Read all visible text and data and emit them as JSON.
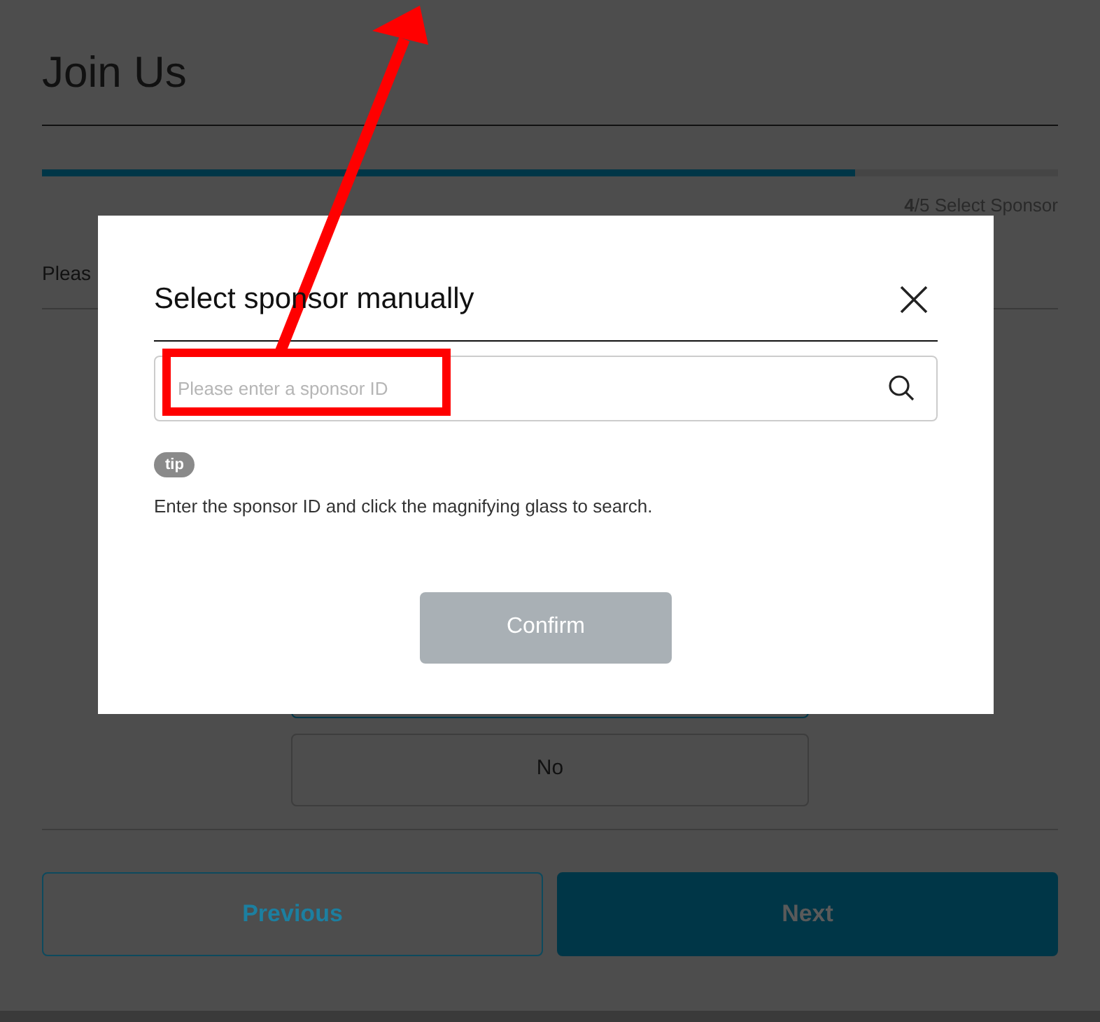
{
  "page": {
    "title": "Join Us",
    "progress": {
      "level": 0.8,
      "step": "**4**/5 Select Sponsor"
    },
    "prompt": "Pleas",
    "options": [
      {
        "label": "No"
      }
    ],
    "buttons": [
      {
        "label": "Previous",
        "kind": "outline"
      },
      {
        "label": "Next",
        "kind": "filled"
      }
    ]
  },
  "dialog": {
    "title": "Select sponsor manually",
    "search": {
      "placeholder": "Please enter a sponsor ID"
    },
    "tip_badge": "tip",
    "tip_text": "Enter the sponsor ID and click the magnifying glass to search.",
    "confirm": {
      "label": "Confirm",
      "disabled": true
    }
  }
}
